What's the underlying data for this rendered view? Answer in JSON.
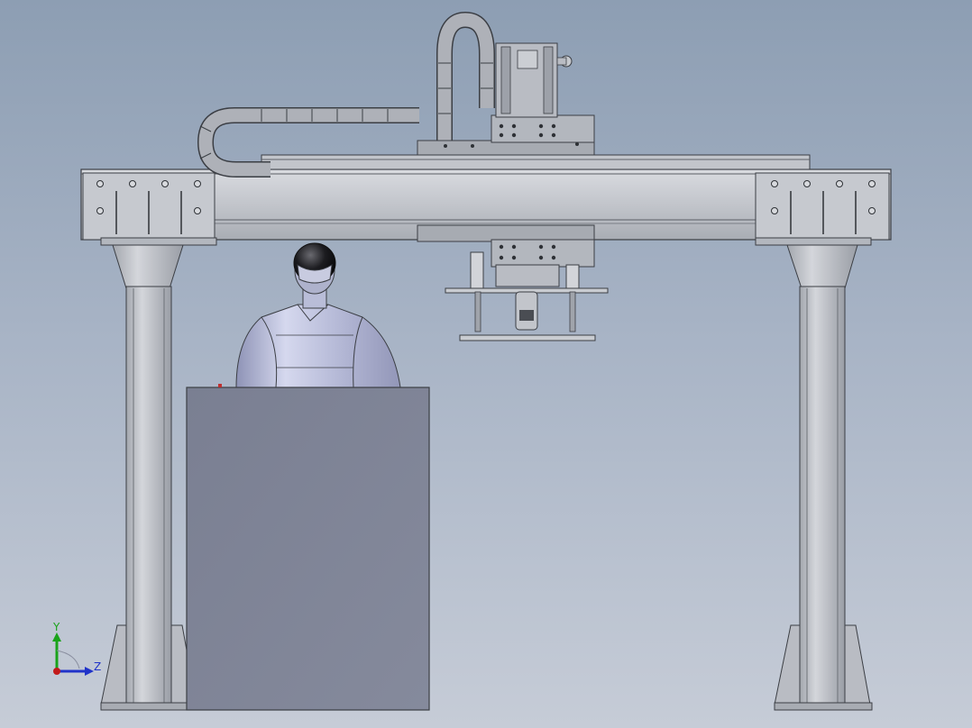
{
  "viewport": {
    "background_top": "#8d9eb3",
    "background_bottom": "#c6ccd7"
  },
  "colors": {
    "steel_light": "#c9ccd1",
    "steel": "#b4b8bf",
    "steel_dark": "#8e939b",
    "outline": "#3b3e44",
    "cabinet": "#7f8497",
    "mannequin": "#b9bdd8",
    "helmet": "#1a1a1d"
  },
  "triad": {
    "y_label": "Y",
    "z_label": "Z",
    "y_color": "#1aa31a",
    "z_color": "#2033c9",
    "x_color": "#c21a1a"
  },
  "icons": [
    "coordinate-triad-icon"
  ]
}
